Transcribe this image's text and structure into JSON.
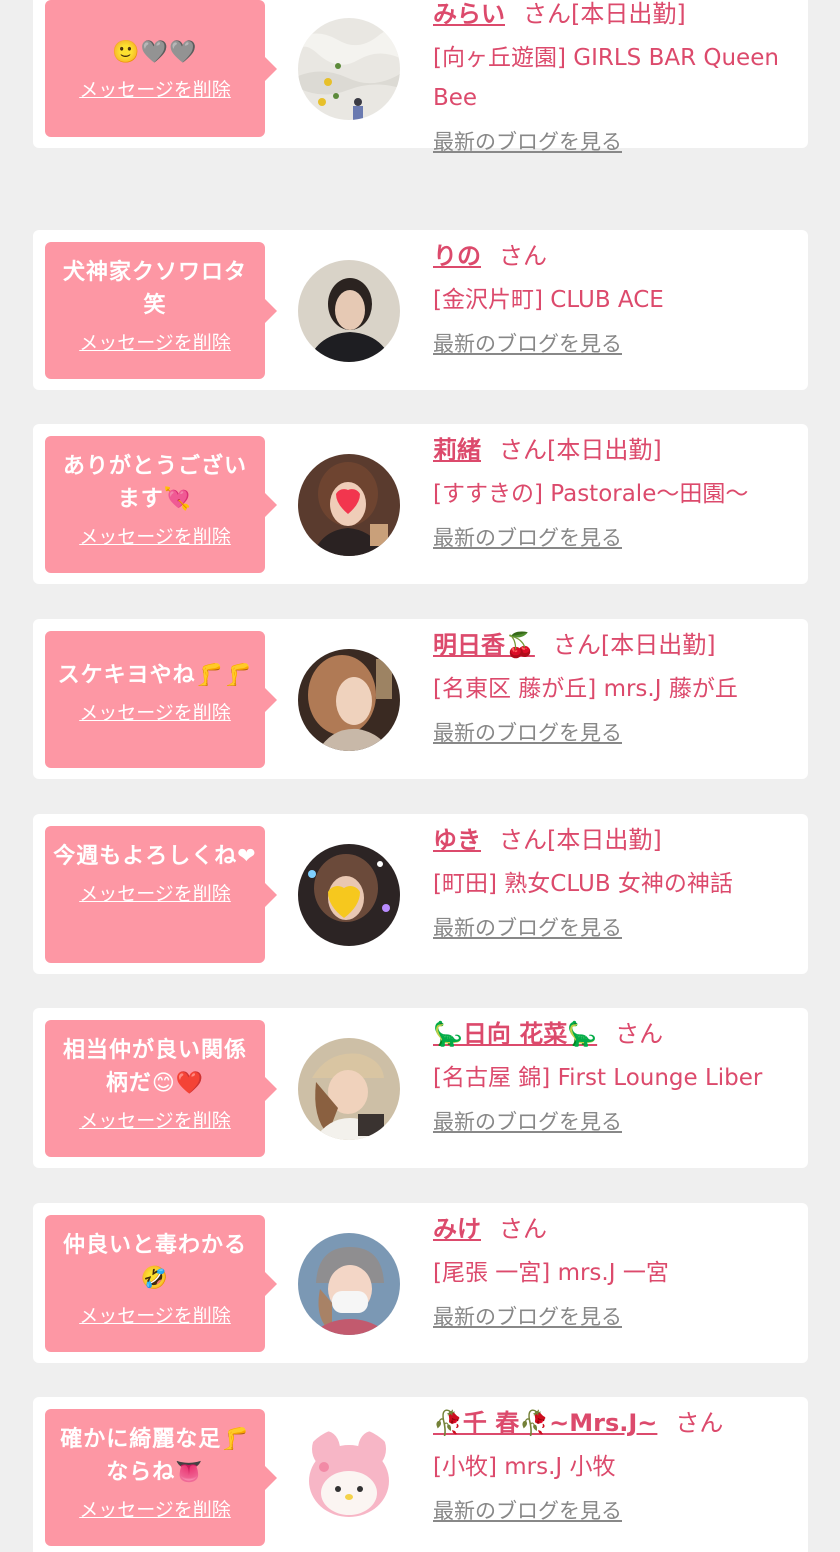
{
  "delete_label": "メッセージを削除",
  "blog_label": "最新のブログを見る",
  "colors": {
    "bubble": "#fd97a4",
    "accent": "#dc4a6c",
    "background": "#efefef",
    "card": "#ffffff",
    "link_gray": "#888888"
  },
  "messages": [
    {
      "message": "🙂🩶🩶",
      "name": "みらい",
      "suffix": "さん[本日出勤]",
      "shop": "[向ヶ丘遊園] GIRLS BAR Queen Bee",
      "avatar_icon": "wall-photo-avatar"
    },
    {
      "message": "犬神家クソワロタ笑",
      "name": "りの",
      "suffix": "さん",
      "shop": "[金沢片町] CLUB ACE",
      "avatar_icon": "woman-portrait-avatar"
    },
    {
      "message": "ありがとうございます💘",
      "name": "莉緒",
      "suffix": "さん[本日出勤]",
      "shop": "[すすきの] Pastorale〜田園〜",
      "avatar_icon": "heart-face-avatar"
    },
    {
      "message": "スケキヨやね🦵🦵",
      "name": "明日香🍒",
      "suffix": "さん[本日出勤]",
      "shop": "[名東区 藤が丘] mrs.J 藤が丘",
      "avatar_icon": "woman-profile-avatar"
    },
    {
      "message": "今週もよろしくね❤",
      "name": "ゆき",
      "suffix": "さん[本日出勤]",
      "shop": "[町田] 熟女CLUB 女神の神話",
      "avatar_icon": "yellow-heart-avatar"
    },
    {
      "message": "相当仲が良い関係柄だ😊❤️",
      "name": "🦕日向 花菜🦕",
      "suffix": "さん",
      "shop": "[名古屋 錦] First Lounge Liber",
      "avatar_icon": "cap-woman-avatar"
    },
    {
      "message": "仲良いと毒わかる🤣",
      "name": "みけ",
      "suffix": "さん",
      "shop": "[尾張 一宮] mrs.J 一宮",
      "avatar_icon": "masked-woman-avatar"
    },
    {
      "message": "確かに綺麗な足🦵ならね👅",
      "name": "🥀千 春🥀~Mrs.J~",
      "suffix": "さん",
      "shop": "[小牧] mrs.J 小牧",
      "avatar_icon": "my-melody-avatar"
    }
  ]
}
